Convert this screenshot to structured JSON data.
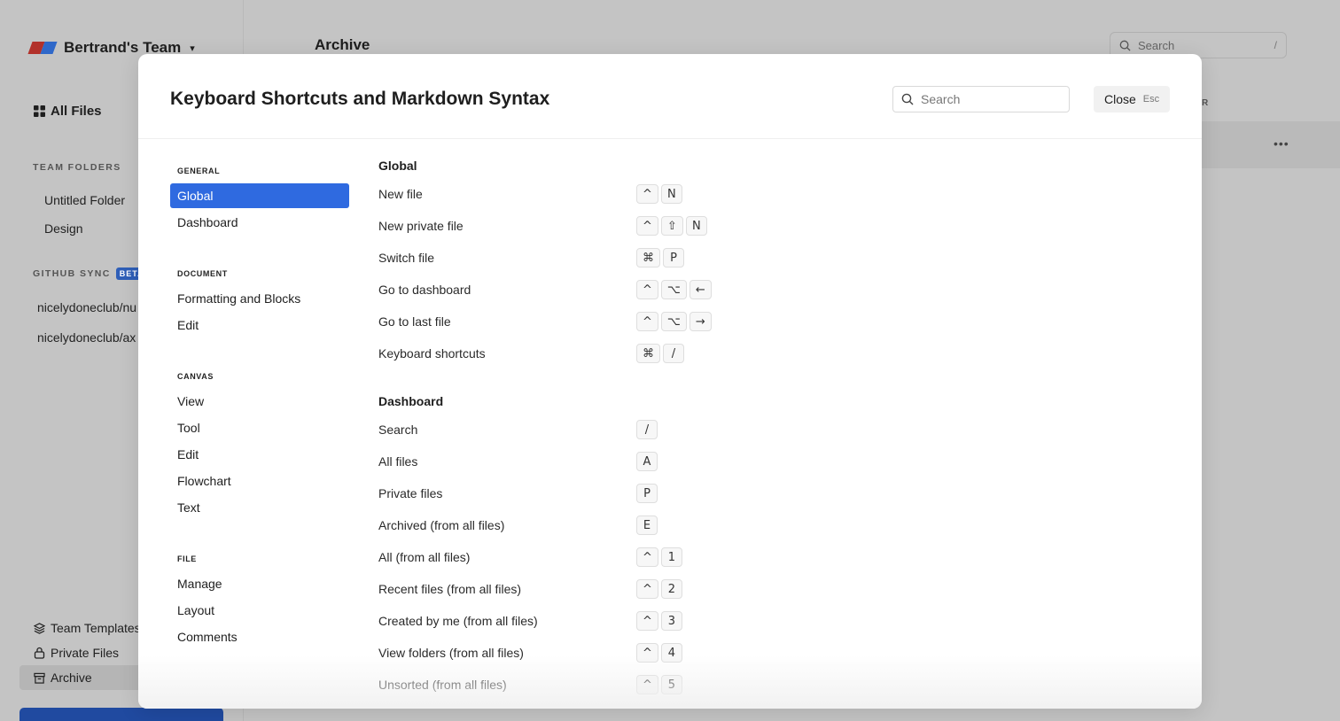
{
  "background": {
    "team_name": "Bertrand's Team",
    "all_files": "All Files",
    "team_folders_heading": "TEAM FOLDERS",
    "team_folders": [
      "Untitled Folder",
      "Design"
    ],
    "github_sync_heading": "GITHUB SYNC",
    "github_badge": "BETA",
    "github_repos": [
      "nicelydoneclub/nu",
      "nicelydoneclub/ax"
    ],
    "bottom_links": [
      "Team Templates",
      "Private Files",
      "Archive"
    ],
    "main_title": "Archive",
    "search_placeholder": "Search",
    "search_hint": "/",
    "column_fragment": "R",
    "more": "•••"
  },
  "modal": {
    "title": "Keyboard Shortcuts and Markdown Syntax",
    "search_placeholder": "Search",
    "close_label": "Close",
    "close_hint": "Esc"
  },
  "nav": [
    {
      "heading": "GENERAL",
      "items": [
        "Global",
        "Dashboard"
      ]
    },
    {
      "heading": "DOCUMENT",
      "items": [
        "Formatting and Blocks",
        "Edit"
      ]
    },
    {
      "heading": "CANVAS",
      "items": [
        "View",
        "Tool",
        "Edit",
        "Flowchart",
        "Text"
      ]
    },
    {
      "heading": "FILE",
      "items": [
        "Manage",
        "Layout",
        "Comments"
      ]
    }
  ],
  "active_nav": "Global",
  "sections": [
    {
      "title": "Global",
      "rows": [
        {
          "label": "New file",
          "keys": [
            "^",
            "N"
          ]
        },
        {
          "label": "New private file",
          "keys": [
            "^",
            "⇧",
            "N"
          ]
        },
        {
          "label": "Switch file",
          "keys": [
            "⌘",
            "P"
          ]
        },
        {
          "label": "Go to dashboard",
          "keys": [
            "^",
            "⌥",
            "←"
          ]
        },
        {
          "label": "Go to last file",
          "keys": [
            "^",
            "⌥",
            "→"
          ]
        },
        {
          "label": "Keyboard shortcuts",
          "keys": [
            "⌘",
            "/"
          ]
        }
      ]
    },
    {
      "title": "Dashboard",
      "rows": [
        {
          "label": "Search",
          "keys": [
            "/"
          ]
        },
        {
          "label": "All files",
          "keys": [
            "A"
          ]
        },
        {
          "label": "Private files",
          "keys": [
            "P"
          ]
        },
        {
          "label": "Archived (from all files)",
          "keys": [
            "E"
          ]
        },
        {
          "label": "All (from all files)",
          "keys": [
            "^",
            "1"
          ]
        },
        {
          "label": "Recent files (from all files)",
          "keys": [
            "^",
            "2"
          ]
        },
        {
          "label": "Created by me (from all files)",
          "keys": [
            "^",
            "3"
          ]
        },
        {
          "label": "View folders (from all files)",
          "keys": [
            "^",
            "4"
          ]
        },
        {
          "label": "Unsorted (from all files)",
          "keys": [
            "^",
            "5"
          ]
        }
      ]
    }
  ],
  "colors": {
    "accent": "#2f6ae0",
    "overlay": "#c4c4c4",
    "brand_red": "#b2312a",
    "brand_blue": "#2f68c9"
  }
}
